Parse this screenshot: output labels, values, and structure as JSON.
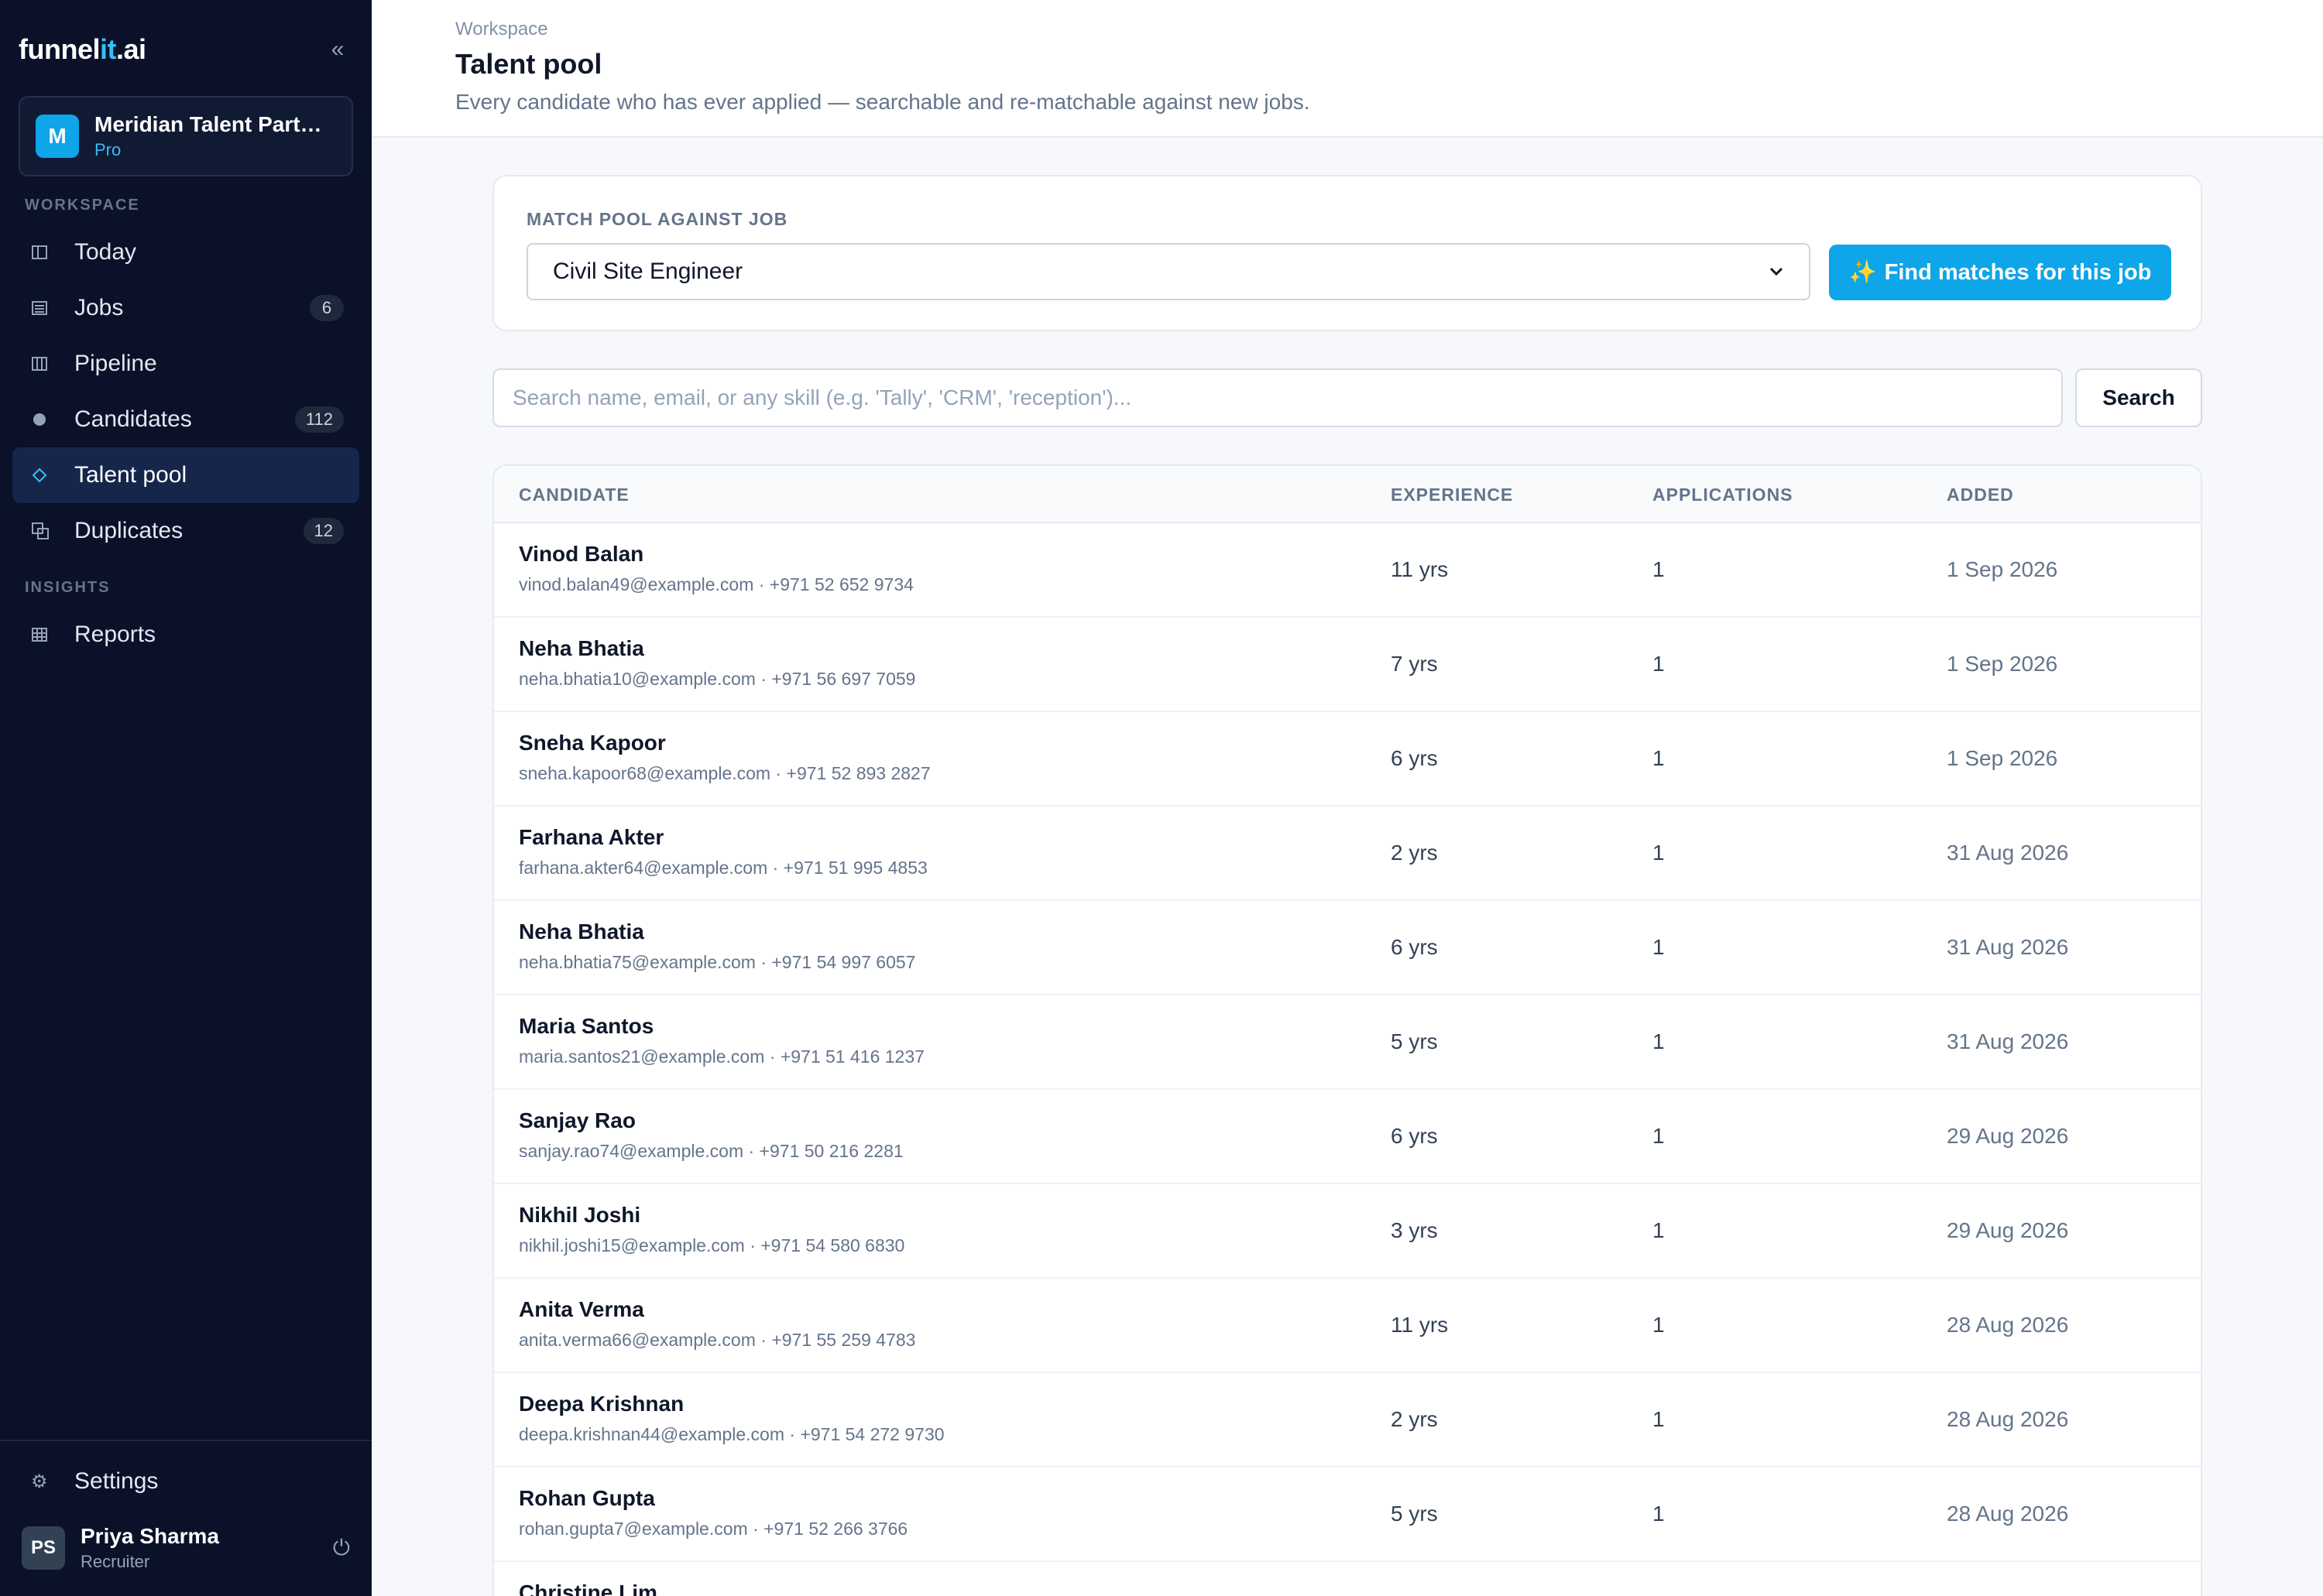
{
  "brand": {
    "logo_part1": "funnel",
    "logo_part2": "it",
    "logo_part3": ".ai"
  },
  "sidebar": {
    "collapse_icon": "double-chevron-left",
    "org": {
      "initial": "M",
      "name": "Meridian Talent Partners",
      "plan": "Pro"
    },
    "section_workspace": "WORKSPACE",
    "section_insights": "INSIGHTS",
    "items": [
      {
        "label": "Today",
        "icon": "layout-icon",
        "badge": ""
      },
      {
        "label": "Jobs",
        "icon": "list-icon",
        "badge": "6"
      },
      {
        "label": "Pipeline",
        "icon": "columns-icon",
        "badge": ""
      },
      {
        "label": "Candidates",
        "icon": "dot-icon",
        "badge": "112"
      },
      {
        "label": "Talent pool",
        "icon": "diamond-icon",
        "badge": ""
      },
      {
        "label": "Duplicates",
        "icon": "copy-icon",
        "badge": "12"
      },
      {
        "label": "Reports",
        "icon": "grid-icon",
        "badge": ""
      }
    ],
    "active_item": "Talent pool",
    "settings_label": "Settings",
    "user": {
      "initials": "PS",
      "name": "Priya Sharma",
      "role": "Recruiter"
    }
  },
  "header": {
    "breadcrumb": "Workspace",
    "title": "Talent pool",
    "subtitle": "Every candidate who has ever applied — searchable and re-matchable against new jobs."
  },
  "match": {
    "label": "MATCH POOL AGAINST JOB",
    "selected_job": "Civil Site Engineer",
    "button_label": "Find matches for this job",
    "button_icon": "✨"
  },
  "search": {
    "placeholder": "Search name, email, or any skill (e.g. 'Tally', 'CRM', 'reception')...",
    "button_label": "Search"
  },
  "table": {
    "columns": [
      "CANDIDATE",
      "EXPERIENCE",
      "APPLICATIONS",
      "ADDED"
    ],
    "rows": [
      {
        "name": "Vinod Balan",
        "contact": "vinod.balan49@example.com · +971 52 652 9734",
        "experience": "11 yrs",
        "applications": "1",
        "added": "1 Sep 2026"
      },
      {
        "name": "Neha Bhatia",
        "contact": "neha.bhatia10@example.com · +971 56 697 7059",
        "experience": "7 yrs",
        "applications": "1",
        "added": "1 Sep 2026"
      },
      {
        "name": "Sneha Kapoor",
        "contact": "sneha.kapoor68@example.com · +971 52 893 2827",
        "experience": "6 yrs",
        "applications": "1",
        "added": "1 Sep 2026"
      },
      {
        "name": "Farhana Akter",
        "contact": "farhana.akter64@example.com · +971 51 995 4853",
        "experience": "2 yrs",
        "applications": "1",
        "added": "31 Aug 2026"
      },
      {
        "name": "Neha Bhatia",
        "contact": "neha.bhatia75@example.com · +971 54 997 6057",
        "experience": "6 yrs",
        "applications": "1",
        "added": "31 Aug 2026"
      },
      {
        "name": "Maria Santos",
        "contact": "maria.santos21@example.com · +971 51 416 1237",
        "experience": "5 yrs",
        "applications": "1",
        "added": "31 Aug 2026"
      },
      {
        "name": "Sanjay Rao",
        "contact": "sanjay.rao74@example.com · +971 50 216 2281",
        "experience": "6 yrs",
        "applications": "1",
        "added": "29 Aug 2026"
      },
      {
        "name": "Nikhil Joshi",
        "contact": "nikhil.joshi15@example.com · +971 54 580 6830",
        "experience": "3 yrs",
        "applications": "1",
        "added": "29 Aug 2026"
      },
      {
        "name": "Anita Verma",
        "contact": "anita.verma66@example.com · +971 55 259 4783",
        "experience": "11 yrs",
        "applications": "1",
        "added": "28 Aug 2026"
      },
      {
        "name": "Deepa Krishnan",
        "contact": "deepa.krishnan44@example.com · +971 54 272 9730",
        "experience": "2 yrs",
        "applications": "1",
        "added": "28 Aug 2026"
      },
      {
        "name": "Rohan Gupta",
        "contact": "rohan.gupta7@example.com · +971 52 266 3766",
        "experience": "5 yrs",
        "applications": "1",
        "added": "28 Aug 2026"
      },
      {
        "name": "Christine Lim",
        "contact": "",
        "experience": "",
        "applications": "",
        "added": ""
      }
    ]
  },
  "colors": {
    "sidebar_bg": "#0a1128",
    "accent": "#0ea5e9",
    "active_bg": "#15264a"
  }
}
